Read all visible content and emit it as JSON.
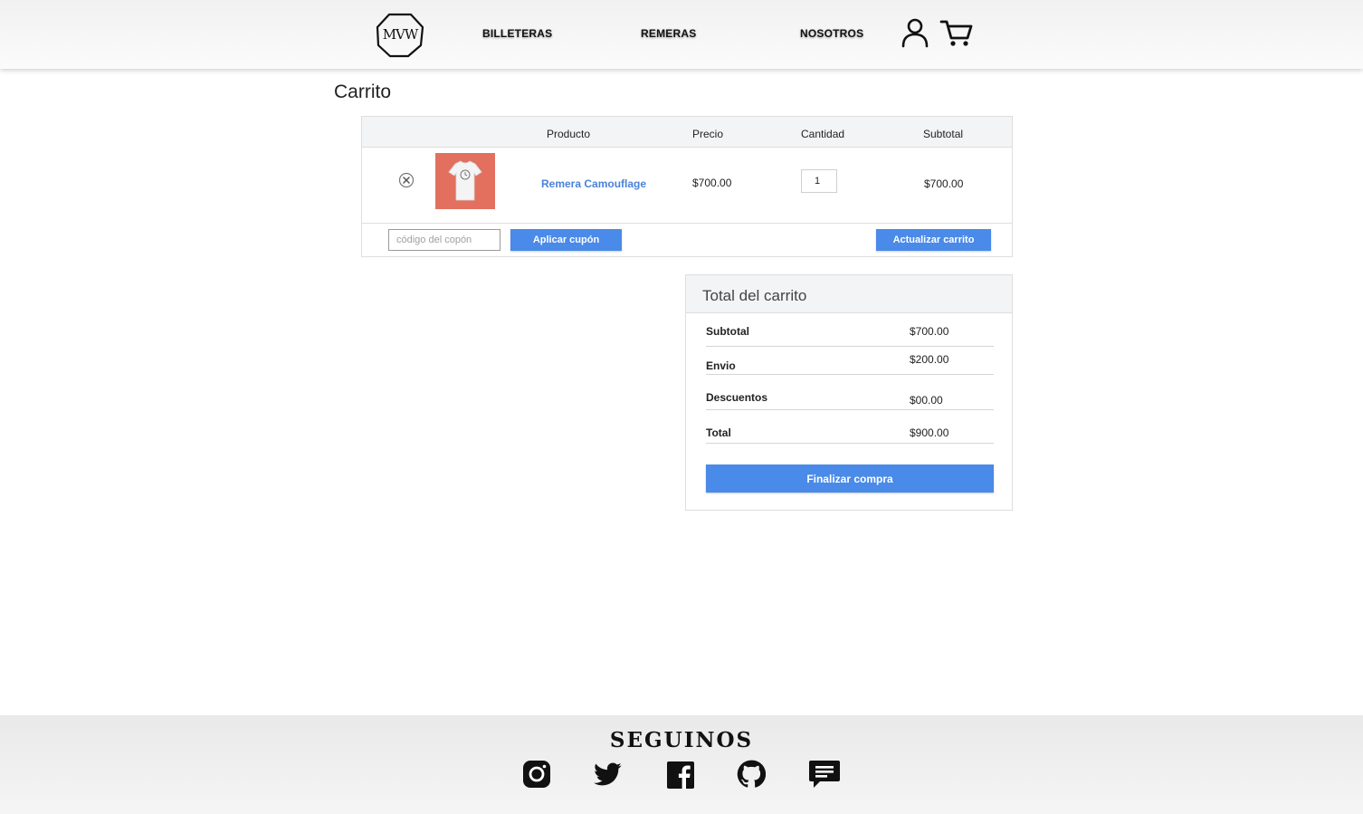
{
  "header": {
    "logo_text": "MVW",
    "nav": {
      "billeteras": "BILLETERAS",
      "remeras": "REMERAS",
      "nosotros": "NOSOTROS"
    },
    "icons": [
      "user-icon",
      "cart-icon"
    ]
  },
  "page": {
    "title": "Carrito"
  },
  "cart": {
    "columns": {
      "producto": "Producto",
      "precio": "Precio",
      "cantidad": "Cantidad",
      "subtotal": "Subtotal"
    },
    "items": [
      {
        "name": "Remera Camouflage",
        "price": "$700.00",
        "quantity": "1",
        "subtotal": "$700.00"
      }
    ],
    "coupon_placeholder": "código del copón",
    "apply_coupon_label": "Aplicar cupón",
    "update_cart_label": "Actualizar carrito"
  },
  "totals": {
    "title": "Total del carrito",
    "rows": [
      {
        "label": "Subtotal",
        "value": "$700.00"
      },
      {
        "label": "Envio",
        "value": "$200.00"
      },
      {
        "label": "Descuentos",
        "value": "$00.00"
      },
      {
        "label": "Total",
        "value": "$900.00"
      }
    ],
    "checkout_label": "Finalizar compra"
  },
  "footer": {
    "title": "SEGUINOS",
    "social_icons": [
      "instagram-icon",
      "twitter-icon",
      "facebook-icon",
      "github-icon",
      "chat-icon"
    ]
  },
  "colors": {
    "accent": "#4a8ae8",
    "link": "#4a82d8",
    "thumb_bg": "#e3705f"
  }
}
